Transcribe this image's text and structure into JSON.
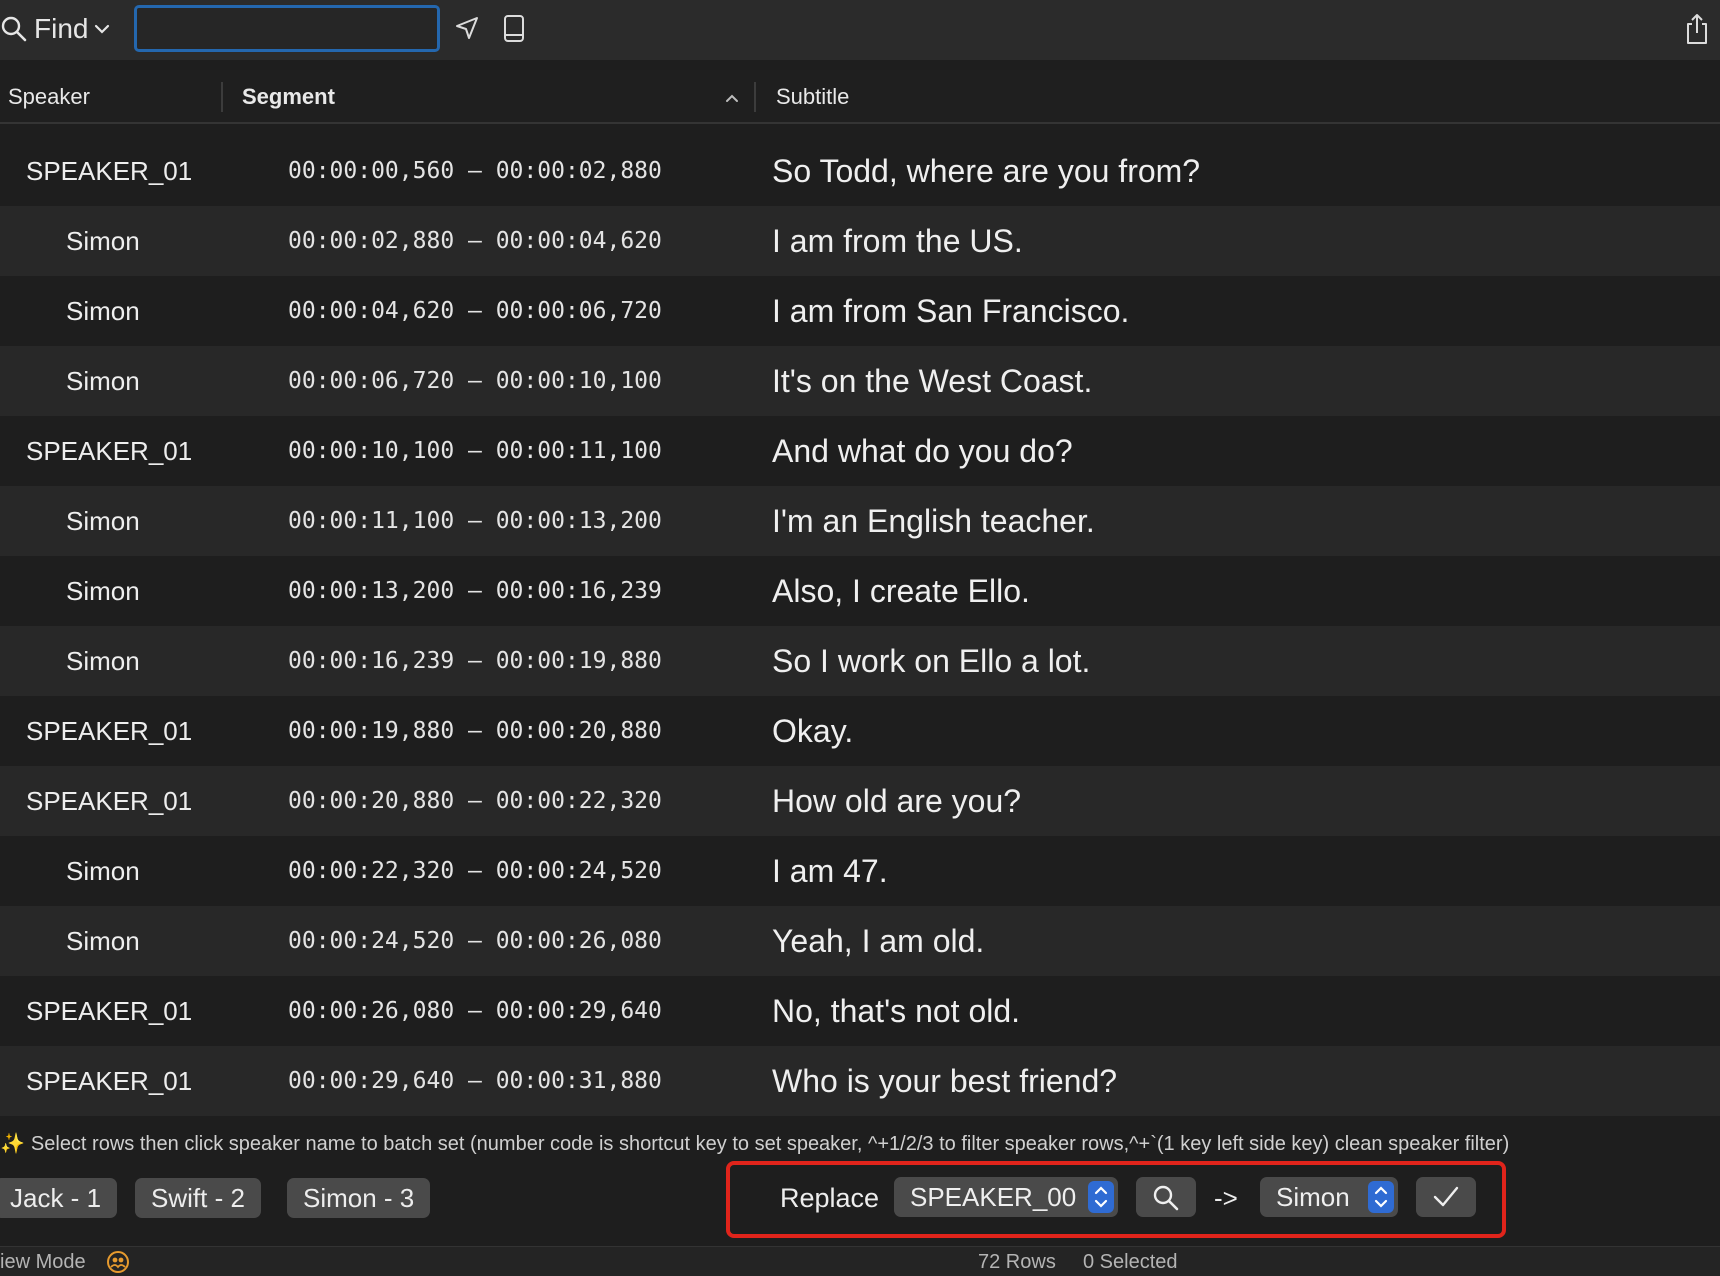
{
  "toolbar": {
    "find_label": "Find",
    "search_value": "",
    "search_placeholder": ""
  },
  "columns": {
    "speaker": "Speaker",
    "segment": "Segment",
    "subtitle": "Subtitle"
  },
  "rows": [
    {
      "speaker": "SPEAKER_01",
      "segment": "00:00:00,560 – 00:00:02,880",
      "subtitle": "So Todd, where are you from?"
    },
    {
      "speaker": "Simon",
      "segment": "00:00:02,880 – 00:00:04,620",
      "subtitle": "I am from the US."
    },
    {
      "speaker": "Simon",
      "segment": "00:00:04,620 – 00:00:06,720",
      "subtitle": "I am from San Francisco."
    },
    {
      "speaker": "Simon",
      "segment": "00:00:06,720 – 00:00:10,100",
      "subtitle": "It's on the West Coast."
    },
    {
      "speaker": "SPEAKER_01",
      "segment": "00:00:10,100 – 00:00:11,100",
      "subtitle": "And what do you do?"
    },
    {
      "speaker": "Simon",
      "segment": "00:00:11,100 – 00:00:13,200",
      "subtitle": "I'm an English teacher."
    },
    {
      "speaker": "Simon",
      "segment": "00:00:13,200 – 00:00:16,239",
      "subtitle": "Also, I create Ello."
    },
    {
      "speaker": "Simon",
      "segment": "00:00:16,239 – 00:00:19,880",
      "subtitle": "So I work on Ello a lot."
    },
    {
      "speaker": "SPEAKER_01",
      "segment": "00:00:19,880 – 00:00:20,880",
      "subtitle": "Okay."
    },
    {
      "speaker": "SPEAKER_01",
      "segment": "00:00:20,880 – 00:00:22,320",
      "subtitle": "How old are you?"
    },
    {
      "speaker": "Simon",
      "segment": "00:00:22,320 – 00:00:24,520",
      "subtitle": "I am 47."
    },
    {
      "speaker": "Simon",
      "segment": "00:00:24,520 – 00:00:26,080",
      "subtitle": "Yeah, I am old."
    },
    {
      "speaker": "SPEAKER_01",
      "segment": "00:00:26,080 – 00:00:29,640",
      "subtitle": "No, that's not old."
    },
    {
      "speaker": "SPEAKER_01",
      "segment": "00:00:29,640 – 00:00:31,880",
      "subtitle": "Who is your best friend?"
    }
  ],
  "hint": {
    "icon": "sparkles-icon",
    "text": "Select rows then click speaker name to batch set (number code is shortcut key to set speaker, ^+1/2/3 to filter speaker rows,^+`(1 key left side key) clean speaker filter)"
  },
  "speaker_buttons": [
    "Jack - 1",
    "Swift - 2",
    "Simon - 3"
  ],
  "replace": {
    "label": "Replace",
    "from_value": "SPEAKER_00",
    "arrow": "->",
    "to_value": "Simon"
  },
  "status": {
    "view_mode": "iew Mode",
    "rows": "72 Rows",
    "selected": "0 Selected"
  },
  "colors": {
    "accent": "#2467ae",
    "highlight_border": "#e0241b",
    "stepper": "#2f6bd3",
    "mode_icon": "#e69a2e"
  }
}
